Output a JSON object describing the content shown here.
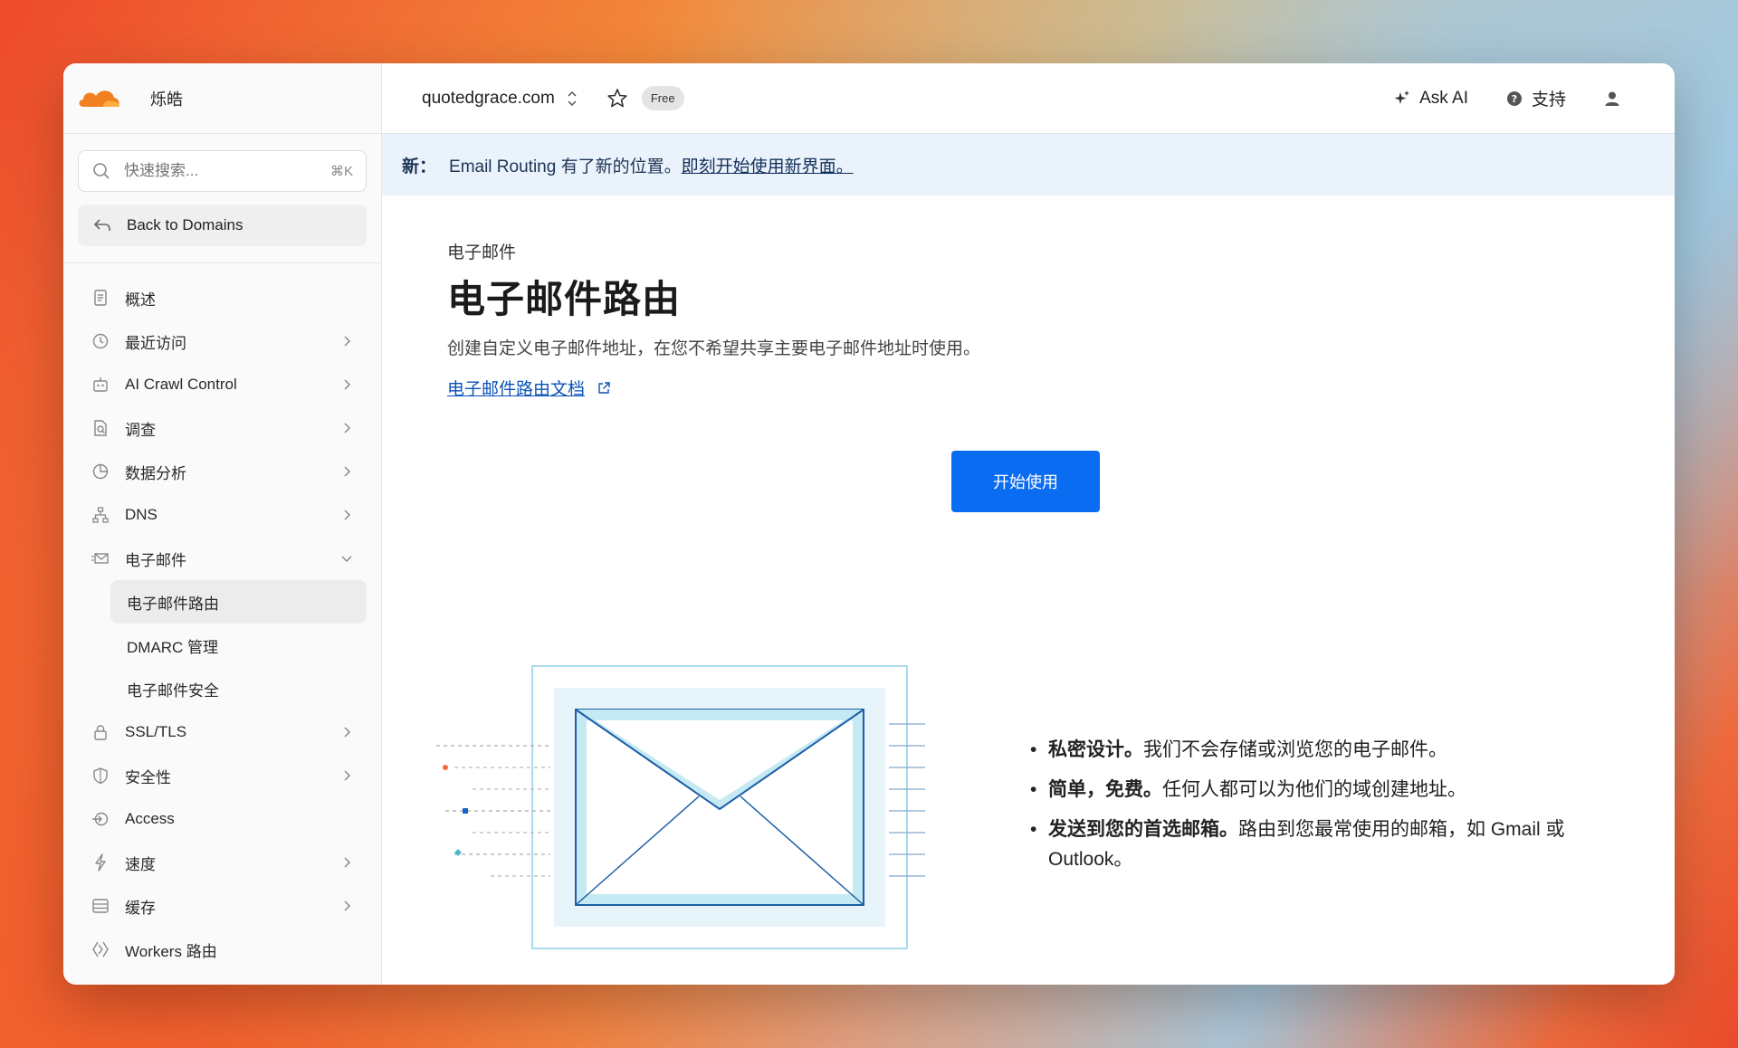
{
  "sidebar": {
    "account_name": "烁皓",
    "search": {
      "placeholder": "快速搜索...",
      "shortcut": "⌘K"
    },
    "back_label": "Back to Domains",
    "items": [
      {
        "label": "概述",
        "icon": "document-icon",
        "chevron": false
      },
      {
        "label": "最近访问",
        "icon": "clock-icon",
        "chevron": true
      },
      {
        "label": "AI Crawl Control",
        "icon": "robot-icon",
        "chevron": true
      },
      {
        "label": "调查",
        "icon": "investigate-icon",
        "chevron": true
      },
      {
        "label": "数据分析",
        "icon": "pie-chart-icon",
        "chevron": true
      },
      {
        "label": "DNS",
        "icon": "network-icon",
        "chevron": true
      },
      {
        "label": "电子邮件",
        "icon": "envelope-icon",
        "chevron": "down"
      }
    ],
    "email_sub": [
      {
        "label": "电子邮件路由",
        "active": true
      },
      {
        "label": "DMARC 管理",
        "active": false
      },
      {
        "label": "电子邮件安全",
        "active": false
      }
    ],
    "items_after": [
      {
        "label": "SSL/TLS",
        "icon": "lock-icon",
        "chevron": true
      },
      {
        "label": "安全性",
        "icon": "shield-icon",
        "chevron": true
      },
      {
        "label": "Access",
        "icon": "access-icon",
        "chevron": false
      },
      {
        "label": "速度",
        "icon": "bolt-icon",
        "chevron": true
      },
      {
        "label": "缓存",
        "icon": "cache-icon",
        "chevron": true
      },
      {
        "label": "Workers 路由",
        "icon": "workers-icon",
        "chevron": false
      }
    ]
  },
  "topbar": {
    "domain": "quotedgrace.com",
    "plan_badge": "Free",
    "ask_ai": "Ask AI",
    "support": "支持"
  },
  "banner": {
    "prefix": "新：",
    "text": "Email Routing 有了新的位置。",
    "link": "即刻开始使用新界面。"
  },
  "page": {
    "eyebrow": "电子邮件",
    "title": "电子邮件路由",
    "description": "创建自定义电子邮件地址，在您不希望共享主要电子邮件地址时使用。",
    "doc_link": "电子邮件路由文档",
    "cta": "开始使用"
  },
  "features": [
    {
      "bold": "私密设计。",
      "text": "我们不会存储或浏览您的电子邮件。"
    },
    {
      "bold": "简单，免费。",
      "text": "任何人都可以为他们的域创建地址。"
    },
    {
      "bold": "发送到您的首选邮箱。",
      "text": "路由到您最常使用的邮箱，如 Gmail 或 Outlook。"
    }
  ],
  "colors": {
    "brand_orange": "#f38020",
    "primary_blue": "#0a6cf0",
    "banner_bg": "#eaf2fb",
    "link_blue": "#0b52b8"
  }
}
